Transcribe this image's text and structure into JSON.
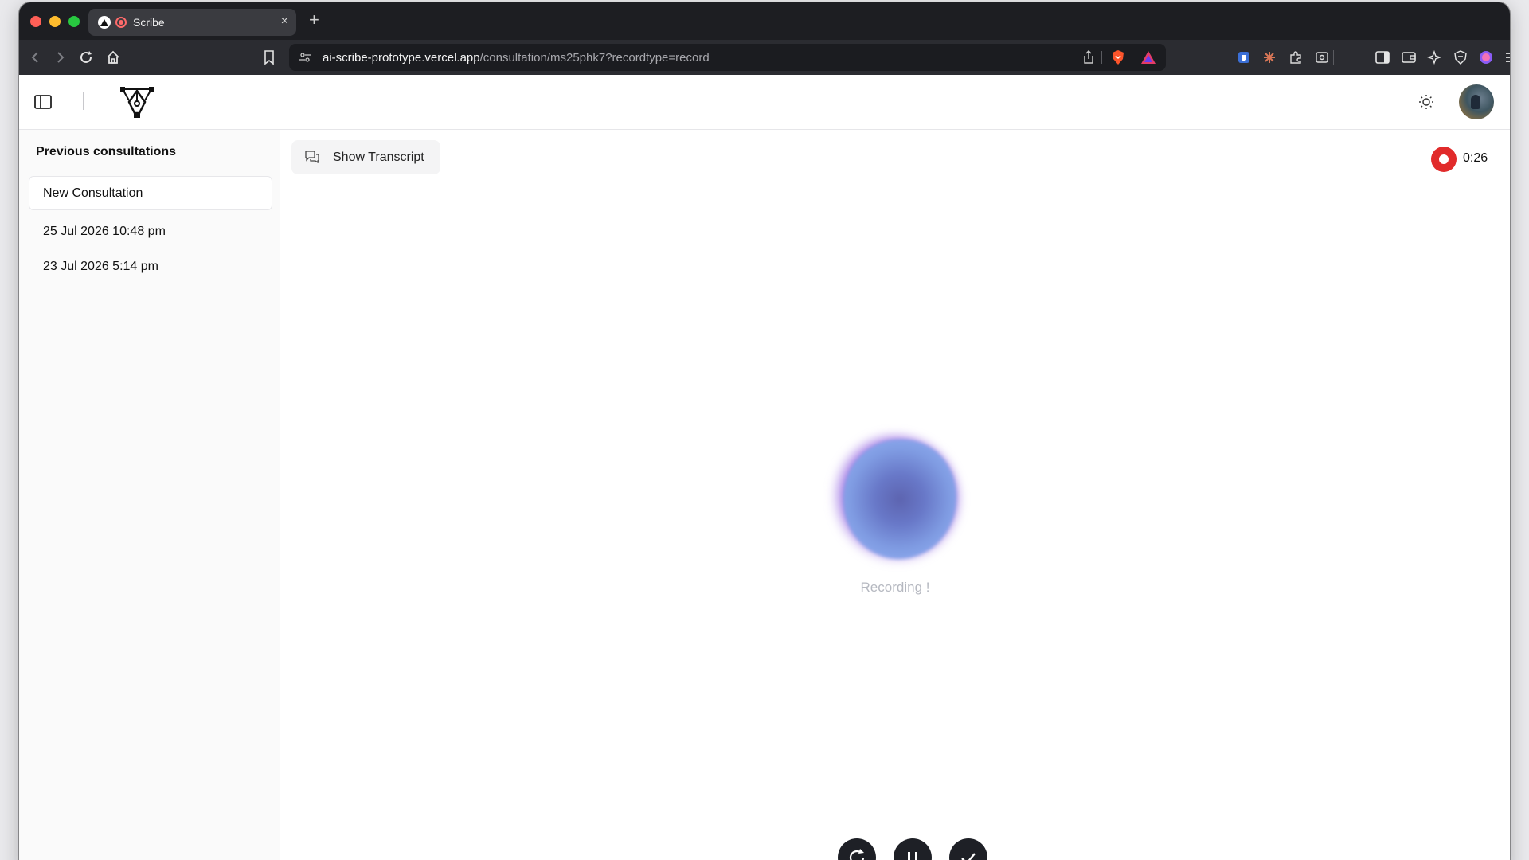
{
  "browser": {
    "tab": {
      "title": "Scribe",
      "close_label": "×"
    },
    "new_tab_label": "+",
    "url_host": "ai-scribe-prototype.vercel.app",
    "url_path": "/consultation/ms25phk7?recordtype=record"
  },
  "sidebar": {
    "heading": "Previous consultations",
    "new_consultation_label": "New Consultation",
    "items": [
      {
        "label": "25 Jul 2026 10:48 pm"
      },
      {
        "label": "23 Jul 2026 5:14 pm"
      }
    ]
  },
  "main": {
    "transcript_button_label": "Show Transcript",
    "timer": "0:26",
    "status_text": "Recording !"
  },
  "colors": {
    "record_red": "#e12b2b",
    "orb_purple": "#9b6fe3",
    "orb_blue": "#6878c8",
    "control_dark": "#1e2026"
  },
  "icons": [
    "back-icon",
    "forward-icon",
    "reload-icon",
    "home-icon",
    "bookmark-icon",
    "site-settings-icon",
    "share-icon",
    "brave-shield-icon",
    "brave-rewards-icon",
    "extension-icons",
    "sidebar-toggle-icon",
    "logo-icon",
    "sun-icon",
    "chat-icon",
    "record-icon",
    "restart-icon",
    "pause-icon",
    "check-icon"
  ]
}
